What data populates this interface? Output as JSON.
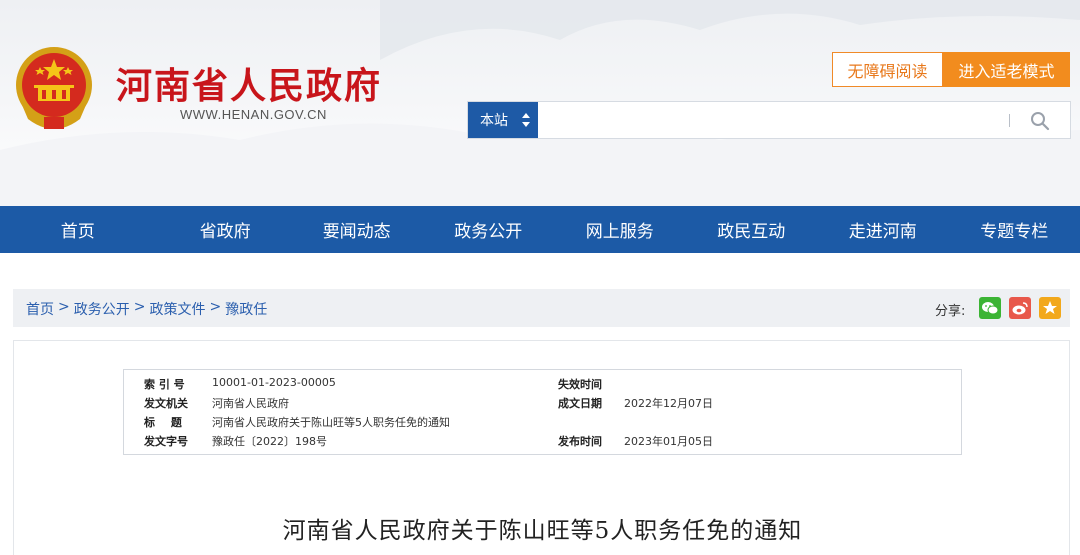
{
  "header": {
    "site_title": "河南省人民政府",
    "site_url": "WWW.HENAN.GOV.CN",
    "accessible_btn": "无障碍阅读",
    "elder_mode_btn": "进入适老模式"
  },
  "search": {
    "scope": "本站",
    "placeholder": ""
  },
  "nav": {
    "items": [
      "首页",
      "省政府",
      "要闻动态",
      "政务公开",
      "网上服务",
      "政民互动",
      "走进河南",
      "专题专栏"
    ]
  },
  "breadcrumb": {
    "items": [
      "首页",
      "政务公开",
      "政策文件",
      "豫政任"
    ],
    "separator": ">"
  },
  "share": {
    "label": "分享:",
    "icons": [
      "wechat-icon",
      "weibo-icon",
      "favorite-icon"
    ]
  },
  "meta": {
    "index_label": "索 引 号",
    "index_value": "10001-01-2023-00005",
    "expire_label": "失效时间",
    "expire_value": "",
    "issuer_label": "发文机关",
    "issuer_value": "河南省人民政府",
    "created_label": "成文日期",
    "created_value": "2022年12月07日",
    "title_label": "标 题",
    "title_value": "河南省人民政府关于陈山旺等5人职务任免的通知",
    "docno_label": "发文字号",
    "docno_value": "豫政任〔2022〕198号",
    "published_label": "发布时间",
    "published_value": "2023年01月05日"
  },
  "document": {
    "title": "河南省人民政府关于陈山旺等5人职务任免的通知"
  },
  "colors": {
    "brand_red": "#c8151b",
    "nav_blue": "#1c5aa6",
    "accent_orange": "#f28c1e"
  }
}
